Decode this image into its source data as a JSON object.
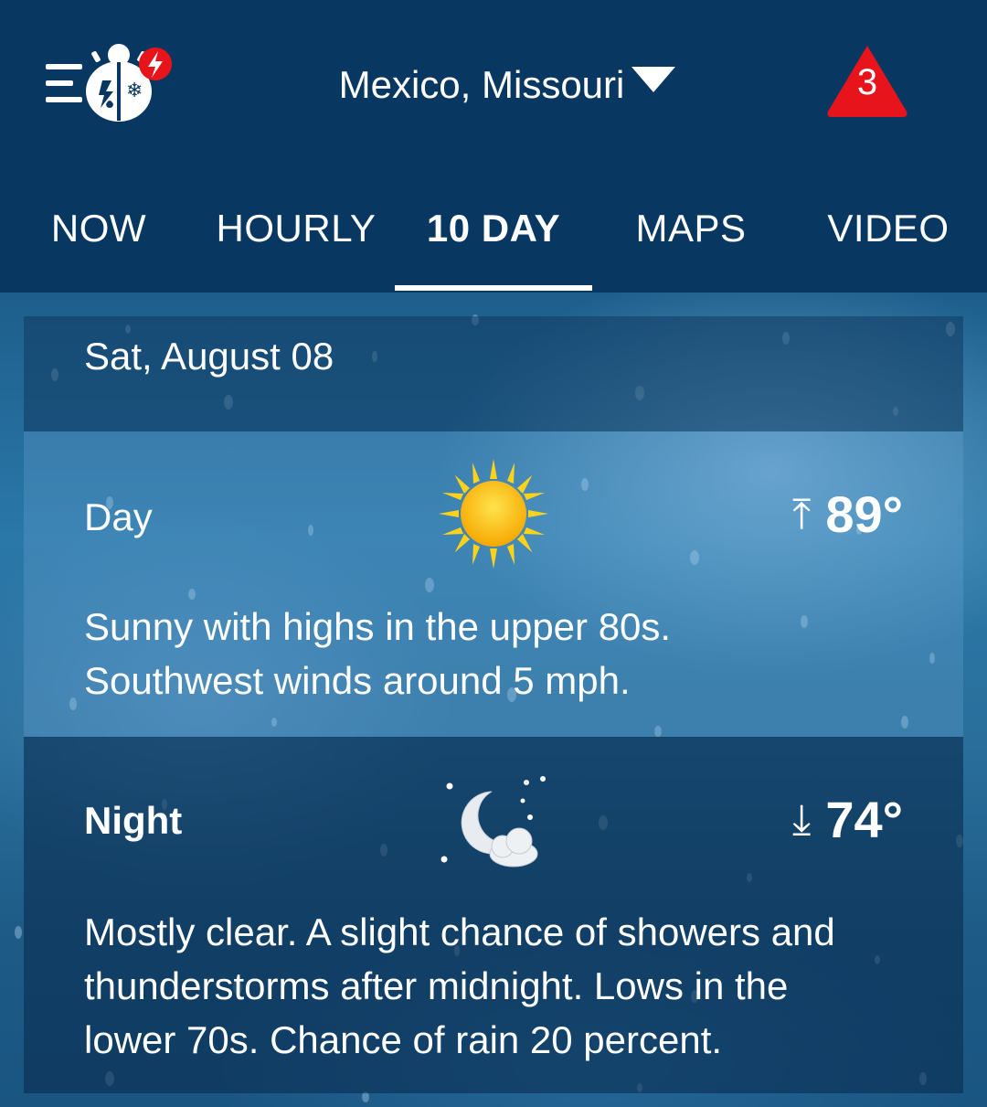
{
  "header": {
    "location": "Mexico, Missouri",
    "alert_count": "3",
    "icons": {
      "menu": "hamburger-icon",
      "logo": "weatherbug-logo-icon",
      "lightning_badge": "lightning-badge-icon",
      "location_caret": "caret-down-icon",
      "alert": "warning-triangle-icon"
    },
    "colors": {
      "header_bg": "#083862",
      "alert_red": "#e8141b"
    }
  },
  "tabs": [
    {
      "label": "NOW",
      "active": false
    },
    {
      "label": "HOURLY",
      "active": false
    },
    {
      "label": "10 DAY",
      "active": true
    },
    {
      "label": "MAPS",
      "active": false
    },
    {
      "label": "VIDEO",
      "active": false
    }
  ],
  "forecast": {
    "date": "Sat, August 08",
    "day": {
      "label": "Day",
      "icon": "sun-icon",
      "temp_arrow": "⤒",
      "temp": "89°",
      "description_line1": "Sunny with highs in the upper 80s.",
      "description_line2": "Southwest winds around 5 mph."
    },
    "night": {
      "label": "Night",
      "icon": "moon-cloud-icon",
      "temp_arrow": "⤓",
      "temp": "74°",
      "description_line1": "Mostly clear. A slight chance of showers and",
      "description_line2": "thunderstorms after midnight. Lows in the",
      "description_line3": "lower 70s. Chance of rain 20 percent."
    }
  }
}
